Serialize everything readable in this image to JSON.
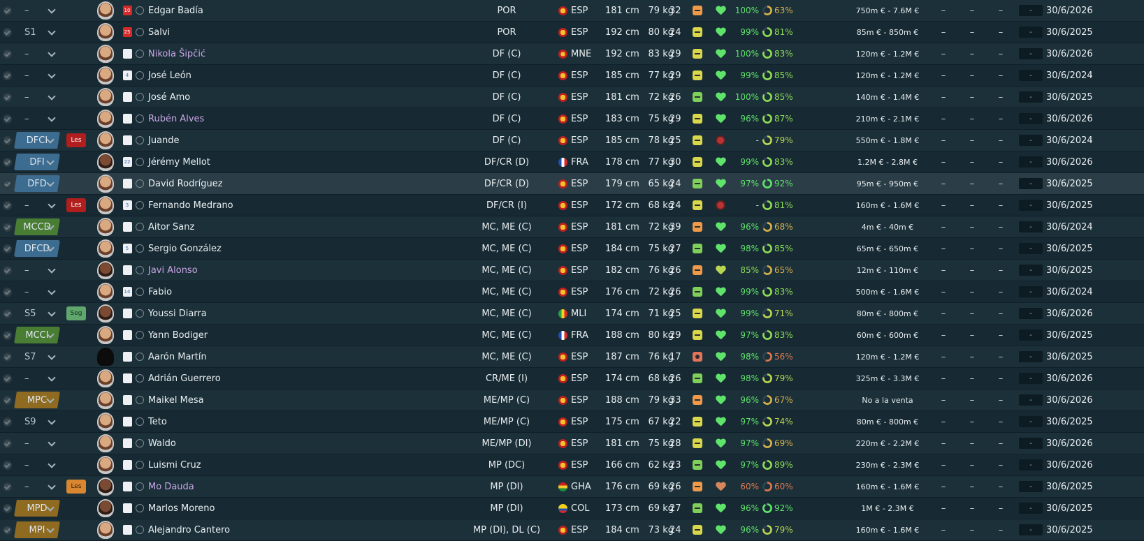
{
  "colors": {
    "good": "#5fe36a",
    "ok": "#b9d652",
    "warn": "#d9b24c",
    "bad": "#e0784f",
    "loan_name": "#c9a6e6"
  },
  "players": [
    {
      "role": "–",
      "role_style": "plain",
      "tag": "",
      "tag_style": "",
      "kit": "10",
      "kit_style": "red",
      "face": "normal",
      "name": "Edgar Badía",
      "loan": false,
      "pos": "POR",
      "nat": "ESP",
      "height": "181 cm",
      "weight": "79 kg",
      "age": "32",
      "morale": "orange",
      "health": "green",
      "cond": "100%",
      "sharp": "63%",
      "value": "750m € - 7.6M €",
      "box": "-",
      "contract": "30/6/2026"
    },
    {
      "role": "S1",
      "role_style": "plain",
      "tag": "",
      "tag_style": "",
      "kit": "25",
      "kit_style": "red",
      "face": "normal",
      "name": "Salvi",
      "loan": false,
      "pos": "POR",
      "nat": "ESP",
      "height": "192 cm",
      "weight": "80 kg",
      "age": "24",
      "morale": "yellow",
      "health": "green",
      "cond": "99%",
      "sharp": "81%",
      "value": "85m € - 850m €",
      "box": "-",
      "contract": "30/6/2025"
    },
    {
      "role": "–",
      "role_style": "plain",
      "tag": "",
      "tag_style": "",
      "kit": "",
      "kit_style": "",
      "face": "normal",
      "name": "Nikola Šipčić",
      "loan": true,
      "pos": "DF (C)",
      "nat": "MNE",
      "height": "192 cm",
      "weight": "83 kg",
      "age": "29",
      "morale": "yellow",
      "health": "green",
      "cond": "100%",
      "sharp": "83%",
      "value": "120m € - 1.2M €",
      "box": "-",
      "contract": "30/6/2026"
    },
    {
      "role": "–",
      "role_style": "plain",
      "tag": "",
      "tag_style": "",
      "kit": "4",
      "kit_style": "",
      "face": "normal",
      "name": "José León",
      "loan": false,
      "pos": "DF (C)",
      "nat": "ESP",
      "height": "185 cm",
      "weight": "77 kg",
      "age": "29",
      "morale": "yellow",
      "health": "green",
      "cond": "99%",
      "sharp": "85%",
      "value": "120m € - 1.2M €",
      "box": "-",
      "contract": "30/6/2024"
    },
    {
      "role": "–",
      "role_style": "plain",
      "tag": "",
      "tag_style": "",
      "kit": "",
      "kit_style": "",
      "face": "normal",
      "name": "José Amo",
      "loan": false,
      "pos": "DF (C)",
      "nat": "ESP",
      "height": "181 cm",
      "weight": "72 kg",
      "age": "26",
      "morale": "green",
      "health": "green",
      "cond": "100%",
      "sharp": "85%",
      "value": "140m € - 1.4M €",
      "box": "-",
      "contract": "30/6/2025"
    },
    {
      "role": "–",
      "role_style": "plain",
      "tag": "",
      "tag_style": "",
      "kit": "",
      "kit_style": "",
      "face": "normal",
      "name": "Rubén Alves",
      "loan": true,
      "pos": "DF (C)",
      "nat": "ESP",
      "height": "183 cm",
      "weight": "75 kg",
      "age": "29",
      "morale": "yellow",
      "health": "green",
      "cond": "96%",
      "sharp": "87%",
      "value": "210m € - 2.1M €",
      "box": "-",
      "contract": "30/6/2026"
    },
    {
      "role": "DFCI",
      "role_style": "blue",
      "tag": "Les",
      "tag_style": "red",
      "kit": "",
      "kit_style": "",
      "face": "normal",
      "name": "Juande",
      "loan": false,
      "pos": "DF (C)",
      "nat": "ESP",
      "height": "185 cm",
      "weight": "78 kg",
      "age": "25",
      "morale": "yellow",
      "health": "injury",
      "cond": "-",
      "sharp": "79%",
      "value": "550m € - 1.8M €",
      "box": "-",
      "contract": "30/6/2024"
    },
    {
      "role": "DFI",
      "role_style": "blue",
      "tag": "",
      "tag_style": "",
      "kit": "22",
      "kit_style": "",
      "face": "dark",
      "name": "Jérémy Mellot",
      "loan": false,
      "pos": "DF/CR (D)",
      "nat": "FRA",
      "height": "178 cm",
      "weight": "77 kg",
      "age": "30",
      "morale": "yellow",
      "health": "green",
      "cond": "99%",
      "sharp": "83%",
      "value": "1.2M € - 2.8M €",
      "box": "-",
      "contract": "30/6/2026"
    },
    {
      "role": "DFD",
      "role_style": "blue",
      "tag": "",
      "tag_style": "",
      "kit": "",
      "kit_style": "",
      "face": "normal",
      "name": "David Rodríguez",
      "loan": false,
      "pos": "DF/CR (D)",
      "nat": "ESP",
      "height": "179 cm",
      "weight": "65 kg",
      "age": "24",
      "morale": "green",
      "health": "green",
      "cond": "97%",
      "sharp": "92%",
      "value": "95m € - 950m €",
      "box": "-",
      "contract": "30/6/2025",
      "selected": true
    },
    {
      "role": "–",
      "role_style": "plain",
      "tag": "Les",
      "tag_style": "red",
      "kit": "3",
      "kit_style": "",
      "face": "normal",
      "name": "Fernando Medrano",
      "loan": false,
      "pos": "DF/CR (I)",
      "nat": "ESP",
      "height": "172 cm",
      "weight": "68 kg",
      "age": "24",
      "morale": "yellow",
      "health": "injury",
      "cond": "-",
      "sharp": "81%",
      "value": "160m € - 1.6M €",
      "box": "-",
      "contract": "30/6/2025"
    },
    {
      "role": "MCCD",
      "role_style": "green",
      "tag": "",
      "tag_style": "",
      "kit": "",
      "kit_style": "",
      "face": "normal",
      "name": "Aitor Sanz",
      "loan": false,
      "pos": "MC, ME (C)",
      "nat": "ESP",
      "height": "181 cm",
      "weight": "72 kg",
      "age": "39",
      "morale": "orange",
      "health": "green",
      "cond": "96%",
      "sharp": "68%",
      "value": "4m € - 40m €",
      "box": "-",
      "contract": "30/6/2024"
    },
    {
      "role": "DFCD",
      "role_style": "blue",
      "tag": "",
      "tag_style": "",
      "kit": "5",
      "kit_style": "",
      "face": "normal",
      "name": "Sergio González",
      "loan": false,
      "pos": "MC, ME (C)",
      "nat": "ESP",
      "height": "184 cm",
      "weight": "75 kg",
      "age": "27",
      "morale": "green",
      "health": "green",
      "cond": "98%",
      "sharp": "85%",
      "value": "65m € - 650m €",
      "box": "-",
      "contract": "30/6/2025"
    },
    {
      "role": "–",
      "role_style": "plain",
      "tag": "",
      "tag_style": "",
      "kit": "",
      "kit_style": "",
      "face": "dark",
      "name": "Javi Alonso",
      "loan": true,
      "pos": "MC, ME (C)",
      "nat": "ESP",
      "height": "182 cm",
      "weight": "76 kg",
      "age": "26",
      "morale": "orange",
      "health": "yellow",
      "cond": "85%",
      "sharp": "65%",
      "value": "12m € - 110m €",
      "box": "-",
      "contract": "30/6/2025"
    },
    {
      "role": "–",
      "role_style": "plain",
      "tag": "",
      "tag_style": "",
      "kit": "14",
      "kit_style": "",
      "face": "normal",
      "name": "Fabio",
      "loan": false,
      "pos": "MC, ME (C)",
      "nat": "ESP",
      "height": "176 cm",
      "weight": "72 kg",
      "age": "26",
      "morale": "green",
      "health": "green",
      "cond": "99%",
      "sharp": "83%",
      "value": "500m € - 1.6M €",
      "box": "-",
      "contract": "30/6/2024"
    },
    {
      "role": "S5",
      "role_style": "plain",
      "tag": "Seg",
      "tag_style": "green",
      "kit": "",
      "kit_style": "",
      "face": "dark",
      "name": "Youssi Diarra",
      "loan": false,
      "pos": "MC, ME (C)",
      "nat": "MLI",
      "height": "174 cm",
      "weight": "71 kg",
      "age": "25",
      "morale": "yellow",
      "health": "green",
      "cond": "99%",
      "sharp": "71%",
      "value": "80m € - 800m €",
      "box": "-",
      "contract": "30/6/2026"
    },
    {
      "role": "MCCI",
      "role_style": "green",
      "tag": "",
      "tag_style": "",
      "kit": "",
      "kit_style": "",
      "face": "normal",
      "name": "Yann Bodiger",
      "loan": false,
      "pos": "MC, ME (C)",
      "nat": "FRA",
      "height": "188 cm",
      "weight": "80 kg",
      "age": "29",
      "morale": "yellow",
      "health": "green",
      "cond": "97%",
      "sharp": "83%",
      "value": "60m € - 600m €",
      "box": "-",
      "contract": "30/6/2025"
    },
    {
      "role": "S7",
      "role_style": "plain",
      "tag": "",
      "tag_style": "",
      "kit": "",
      "kit_style": "",
      "face": "silhouette",
      "name": "Aarón Martín",
      "loan": false,
      "pos": "MC, ME (C)",
      "nat": "ESP",
      "height": "187 cm",
      "weight": "76 kg",
      "age": "17",
      "morale": "red",
      "health": "green",
      "cond": "98%",
      "sharp": "56%",
      "value": "120m € - 1.2M €",
      "box": "-",
      "contract": "30/6/2025"
    },
    {
      "role": "–",
      "role_style": "plain",
      "tag": "",
      "tag_style": "",
      "kit": "",
      "kit_style": "",
      "face": "normal",
      "name": "Adrián Guerrero",
      "loan": false,
      "pos": "CR/ME (I)",
      "nat": "ESP",
      "height": "174 cm",
      "weight": "68 kg",
      "age": "26",
      "morale": "green",
      "health": "green",
      "cond": "98%",
      "sharp": "79%",
      "value": "325m € - 3.3M €",
      "box": "-",
      "contract": "30/6/2026"
    },
    {
      "role": "MPC",
      "role_style": "gold",
      "tag": "",
      "tag_style": "",
      "kit": "",
      "kit_style": "",
      "face": "normal",
      "name": "Maikel Mesa",
      "loan": false,
      "pos": "ME/MP (C)",
      "nat": "ESP",
      "height": "188 cm",
      "weight": "79 kg",
      "age": "33",
      "morale": "orange",
      "health": "green",
      "cond": "96%",
      "sharp": "67%",
      "value": "No a la venta",
      "box": "-",
      "contract": "30/6/2026"
    },
    {
      "role": "S9",
      "role_style": "plain",
      "tag": "",
      "tag_style": "",
      "kit": "",
      "kit_style": "",
      "face": "normal",
      "name": "Teto",
      "loan": false,
      "pos": "ME/MP (C)",
      "nat": "ESP",
      "height": "175 cm",
      "weight": "67 kg",
      "age": "22",
      "morale": "yellow",
      "health": "green",
      "cond": "97%",
      "sharp": "74%",
      "value": "80m € - 800m €",
      "box": "-",
      "contract": "30/6/2025"
    },
    {
      "role": "–",
      "role_style": "plain",
      "tag": "",
      "tag_style": "",
      "kit": "",
      "kit_style": "",
      "face": "normal",
      "name": "Waldo",
      "loan": false,
      "pos": "ME/MP (DI)",
      "nat": "ESP",
      "height": "181 cm",
      "weight": "75 kg",
      "age": "28",
      "morale": "yellow",
      "health": "green",
      "cond": "97%",
      "sharp": "69%",
      "value": "220m € - 2.2M €",
      "box": "-",
      "contract": "30/6/2026"
    },
    {
      "role": "–",
      "role_style": "plain",
      "tag": "",
      "tag_style": "",
      "kit": "",
      "kit_style": "",
      "face": "normal",
      "name": "Luismi Cruz",
      "loan": false,
      "pos": "MP (DC)",
      "nat": "ESP",
      "height": "166 cm",
      "weight": "62 kg",
      "age": "23",
      "morale": "green",
      "health": "green",
      "cond": "97%",
      "sharp": "89%",
      "value": "230m € - 2.3M €",
      "box": "-",
      "contract": "30/6/2026"
    },
    {
      "role": "–",
      "role_style": "plain",
      "tag": "Les",
      "tag_style": "orange",
      "kit": "",
      "kit_style": "",
      "face": "dark",
      "name": "Mo Dauda",
      "loan": true,
      "pos": "MP (DI)",
      "nat": "GHA",
      "height": "176 cm",
      "weight": "69 kg",
      "age": "26",
      "morale": "orange",
      "health": "orange",
      "cond": "60%",
      "sharp": "60%",
      "value": "160m € - 1.6M €",
      "box": "-",
      "contract": "30/6/2025"
    },
    {
      "role": "MPD",
      "role_style": "gold",
      "tag": "",
      "tag_style": "",
      "kit": "",
      "kit_style": "",
      "face": "dark",
      "name": "Marlos Moreno",
      "loan": false,
      "pos": "MP (DI)",
      "nat": "COL",
      "height": "173 cm",
      "weight": "69 kg",
      "age": "27",
      "morale": "green",
      "health": "green",
      "cond": "96%",
      "sharp": "92%",
      "value": "1M € - 2.3M €",
      "box": "-",
      "contract": "30/6/2025"
    },
    {
      "role": "MPI",
      "role_style": "gold",
      "tag": "",
      "tag_style": "",
      "kit": "",
      "kit_style": "",
      "face": "normal",
      "name": "Alejandro Cantero",
      "loan": false,
      "pos": "MP (DI), DL (C)",
      "nat": "ESP",
      "height": "184 cm",
      "weight": "73 kg",
      "age": "24",
      "morale": "yellow",
      "health": "green",
      "cond": "96%",
      "sharp": "79%",
      "value": "160m € - 1.6M €",
      "box": "-",
      "contract": "30/6/2025"
    }
  ]
}
